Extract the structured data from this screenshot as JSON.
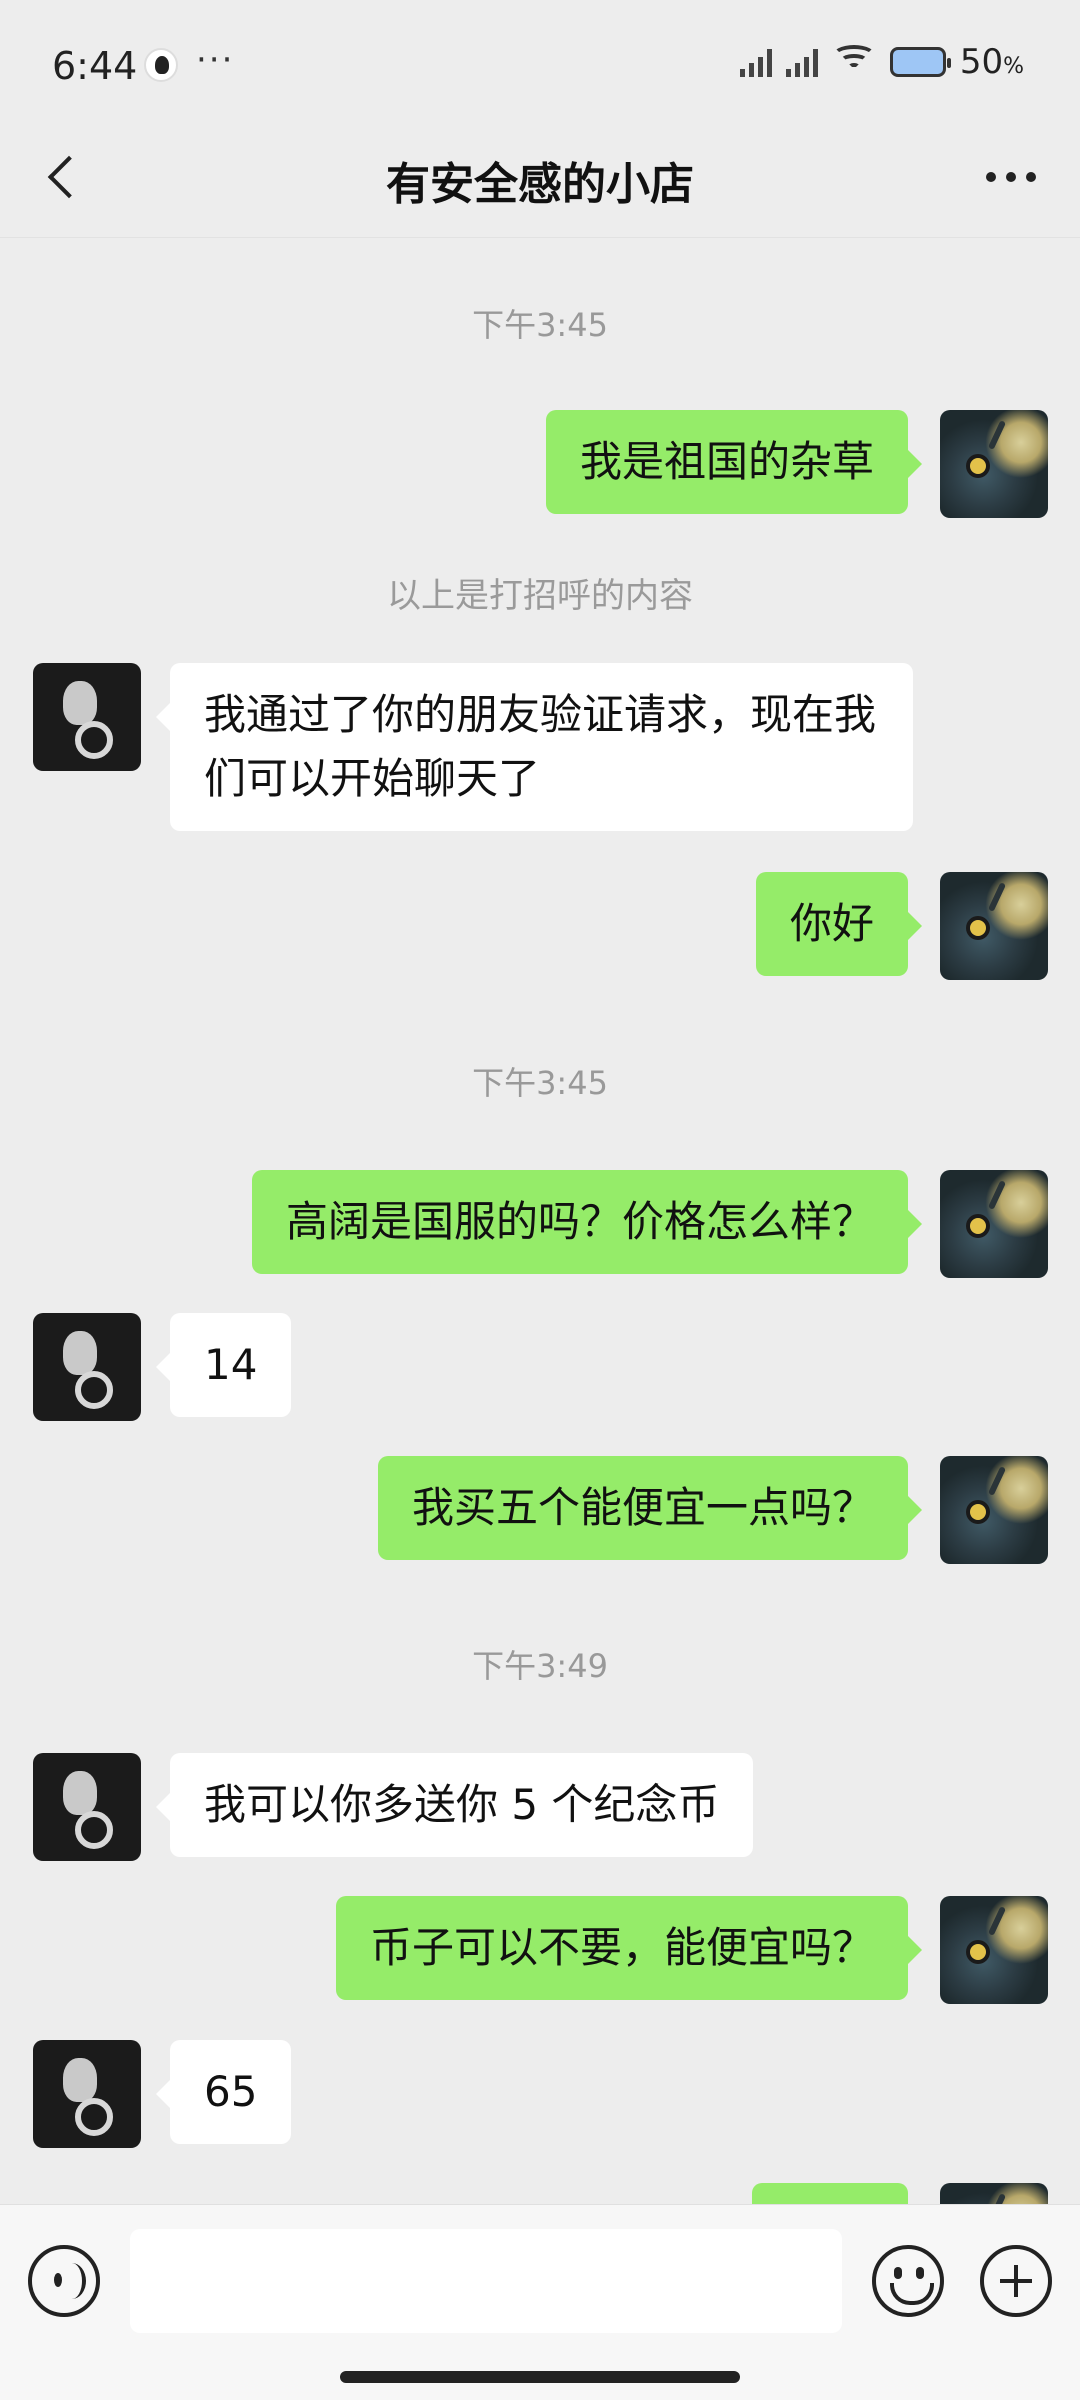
{
  "status_bar": {
    "time": "6:44",
    "more": "···",
    "battery_percent": "50",
    "battery_unit": "%",
    "app_icon": "qq-penguin-icon",
    "icons": [
      "signal-icon",
      "signal-icon",
      "wifi-icon",
      "battery-icon"
    ]
  },
  "header": {
    "title": "有安全感的小店",
    "back_icon": "chevron-left-icon",
    "more_icon": "more-horizontal-icon"
  },
  "chat": {
    "timestamps": [
      "下午3:45",
      "下午3:45",
      "下午3:49"
    ],
    "greeting_note": "以上是打招呼的内容",
    "messages": [
      {
        "sender": "me",
        "text": "我是祖国的杂草"
      },
      {
        "sender": "other",
        "text": "我通过了你的朋友验证请求，现在我们可以开始聊天了"
      },
      {
        "sender": "me",
        "text": "你好"
      },
      {
        "sender": "me",
        "text": "高阔是国服的吗？价格怎么样？"
      },
      {
        "sender": "other",
        "text": "14"
      },
      {
        "sender": "me",
        "text": "我买五个能便宜一点吗？"
      },
      {
        "sender": "other",
        "text": "我可以你多送你 5 个纪念币"
      },
      {
        "sender": "me",
        "text": "币子可以不要，能便宜吗？"
      },
      {
        "sender": "other",
        "text": "65"
      }
    ]
  },
  "input_bar": {
    "text_value": "",
    "icons": [
      "voice-icon",
      "emoji-icon",
      "plus-icon"
    ]
  },
  "colors": {
    "background": "#ededed",
    "my_bubble": "#95ec69",
    "other_bubble": "#ffffff"
  }
}
